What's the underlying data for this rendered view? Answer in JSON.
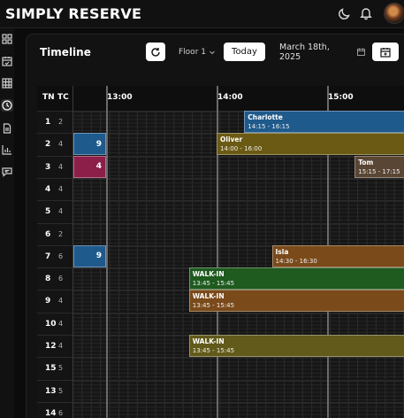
{
  "app": {
    "brand": "SIMPLY RESERVE"
  },
  "header_icons": [
    "moon-icon",
    "bell-icon"
  ],
  "sidebar": {
    "items": [
      {
        "name": "dashboard-icon"
      },
      {
        "name": "calendar-check-icon"
      },
      {
        "name": "table-grid-icon"
      },
      {
        "name": "clock-icon",
        "active": true
      },
      {
        "name": "document-icon"
      },
      {
        "name": "bar-chart-icon"
      },
      {
        "name": "chat-icon"
      }
    ]
  },
  "toolbar": {
    "title": "Timeline",
    "floor": "Floor 1",
    "today_label": "Today",
    "date": "March 18th, 2025"
  },
  "grid": {
    "hdr_tn": "TN",
    "hdr_tc": "TC",
    "times": [
      "13:00",
      "14:00",
      "15:00"
    ],
    "rows": [
      {
        "tn": "1",
        "tc": "2"
      },
      {
        "tn": "2",
        "tc": "4"
      },
      {
        "tn": "3",
        "tc": "4"
      },
      {
        "tn": "4",
        "tc": "4"
      },
      {
        "tn": "5",
        "tc": "4"
      },
      {
        "tn": "6",
        "tc": "2"
      },
      {
        "tn": "7",
        "tc": "6"
      },
      {
        "tn": "8",
        "tc": "6"
      },
      {
        "tn": "9",
        "tc": "4"
      },
      {
        "tn": "10",
        "tc": "4"
      },
      {
        "tn": "12",
        "tc": "4"
      },
      {
        "tn": "15",
        "tc": "5"
      },
      {
        "tn": "13",
        "tc": "5"
      },
      {
        "tn": "14",
        "tc": "6"
      }
    ],
    "reservations": [
      {
        "row": 0,
        "name": "Charlotte",
        "time": "14:15 - 16:15",
        "color": "#1f5a8c"
      },
      {
        "row": 1,
        "name": "Oliver",
        "time": "14:00 - 16:00",
        "color": "#6b5a14"
      },
      {
        "row": 2,
        "name": "Tom",
        "time": "15:15 - 17:15",
        "color": "#5a4634"
      },
      {
        "row": 6,
        "name": "Isla",
        "time": "14:30 - 16:30",
        "color": "#7a4a1a"
      },
      {
        "row": 7,
        "name": "WALK-IN",
        "time": "13:45 - 15:45",
        "color": "#1f5a1f"
      },
      {
        "row": 8,
        "name": "WALK-IN",
        "time": "13:45 - 15:45",
        "color": "#7a4a1a"
      },
      {
        "row": 10,
        "name": "WALK-IN",
        "time": "13:45 - 15:45",
        "color": "#625a1a"
      }
    ],
    "mini_blocks": [
      {
        "row": 1,
        "label": "9",
        "color": "#1f5a8c"
      },
      {
        "row": 2,
        "label": "4",
        "color": "#8c1f4a"
      },
      {
        "row": 6,
        "label": "9",
        "color": "#1f5a8c"
      }
    ]
  }
}
